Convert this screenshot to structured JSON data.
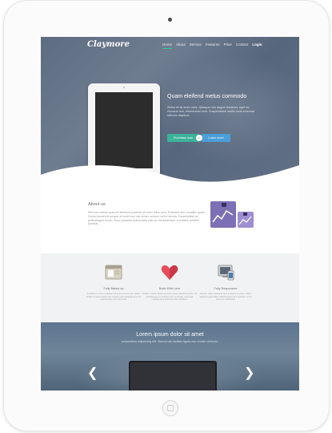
{
  "site": {
    "logo": "Claymore",
    "nav": [
      {
        "label": "Home"
      },
      {
        "label": "About"
      },
      {
        "label": "Service"
      },
      {
        "label": "Features"
      },
      {
        "label": "Price"
      },
      {
        "label": "Contact"
      },
      {
        "label": "Login"
      }
    ]
  },
  "hero": {
    "headline": "Quam eleifend metus commodo",
    "lead": "Siclus et all amet urna. Quisque non augue tincidunt, eget as rhoncus non, elementum sem. Suspendisse mollis nulla euismod ultricies dapibus.",
    "purchase_label": "Purchase now",
    "or_label": "or",
    "learn_label": "Learn more"
  },
  "about": {
    "title": "About us",
    "text": "Sed nec massa quis nisl tincidunt posuere sit amet tellus sem. Praesent sed convallis quam. Donec hendrerit congue sit amet sed nisi ornare semper lorem lacinia. Suspendisse ac pellentesque lorem. Nunc pharetra malesuada odio ac condimentum. Curabitur porttitor pulvinar."
  },
  "features": [
    {
      "title": "Fully Baked up",
      "icon": "window-icon",
      "text": "Curabitur in eros et aliquam risus ac posuere dis. Quam facilisi sit amet sapien nec posuere nisl. Molestie lacus ac pellentesque orci eros vitae."
    },
    {
      "title": "Build With Love",
      "icon": "heart-icon",
      "text": "Sodales fuignim libero est sed cursus, adipiscing Duis nec pellentesque eu volutpat nam ut integer venenatis molestie eros iaculis et vitae tincidunt."
    },
    {
      "title": "Fully Responsive",
      "icon": "devices-icon",
      "text": "Aliquam tellus mauris at vero tincidunt ac proin, nullam adipiscing elit etiam pharetra lacus sit et lobortis orci at eros non sollicitudin."
    }
  ],
  "bottom": {
    "title": "Lorem ipsum dolor sit amet",
    "subtitle": "consectetur adipiscing elit. Maecenas facilisis ligula non ornare vehicula."
  },
  "colors": {
    "accent_green": "#3bb39a",
    "accent_blue": "#4a9fd8",
    "heart_red": "#e74c5b"
  }
}
